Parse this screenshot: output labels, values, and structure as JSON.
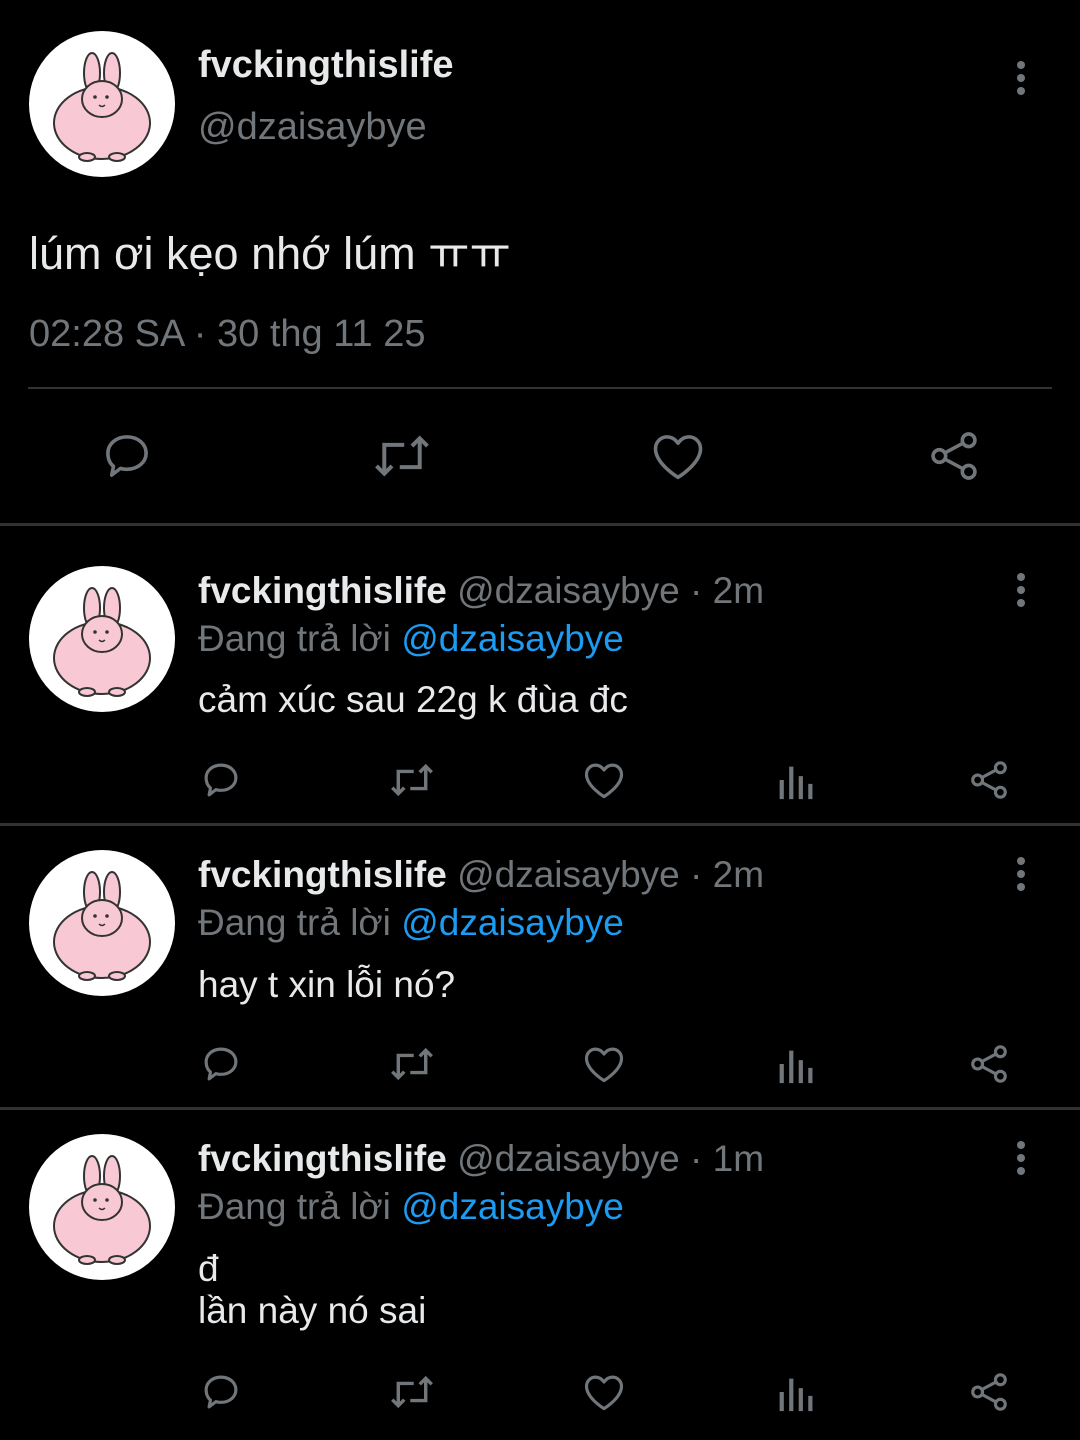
{
  "main_tweet": {
    "display_name": "fvckingthislife",
    "handle": "@dzaisaybye",
    "text": "lúm ơi kẹo nhớ lúm ㅠㅠ",
    "timestamp": "02:28 SA · 30 thg 11 25",
    "actions": [
      "reply-icon",
      "retweet-icon",
      "like-icon",
      "share-icon"
    ]
  },
  "replies": [
    {
      "display_name": "fvckingthislife",
      "meta": "@dzaisaybye · 2m",
      "replying_prefix": "Đang trả lời",
      "replying_to": "@dzaisaybye",
      "text_lines": [
        "cảm xúc sau 22g k đùa đc"
      ]
    },
    {
      "display_name": "fvckingthislife",
      "meta": "@dzaisaybye · 2m",
      "replying_prefix": "Đang trả lời",
      "replying_to": "@dzaisaybye",
      "text_lines": [
        "hay t xin lỗi nó?"
      ]
    },
    {
      "display_name": "fvckingthislife",
      "meta": "@dzaisaybye · 1m",
      "replying_prefix": "Đang trả lời",
      "replying_to": "@dzaisaybye",
      "text_lines": [
        "đ",
        "lần này nó sai"
      ]
    }
  ],
  "colors": {
    "background": "#000000",
    "text": "#e7e9ea",
    "secondary": "#71767b",
    "link": "#1d9bf0",
    "divider": "#2f3336"
  }
}
